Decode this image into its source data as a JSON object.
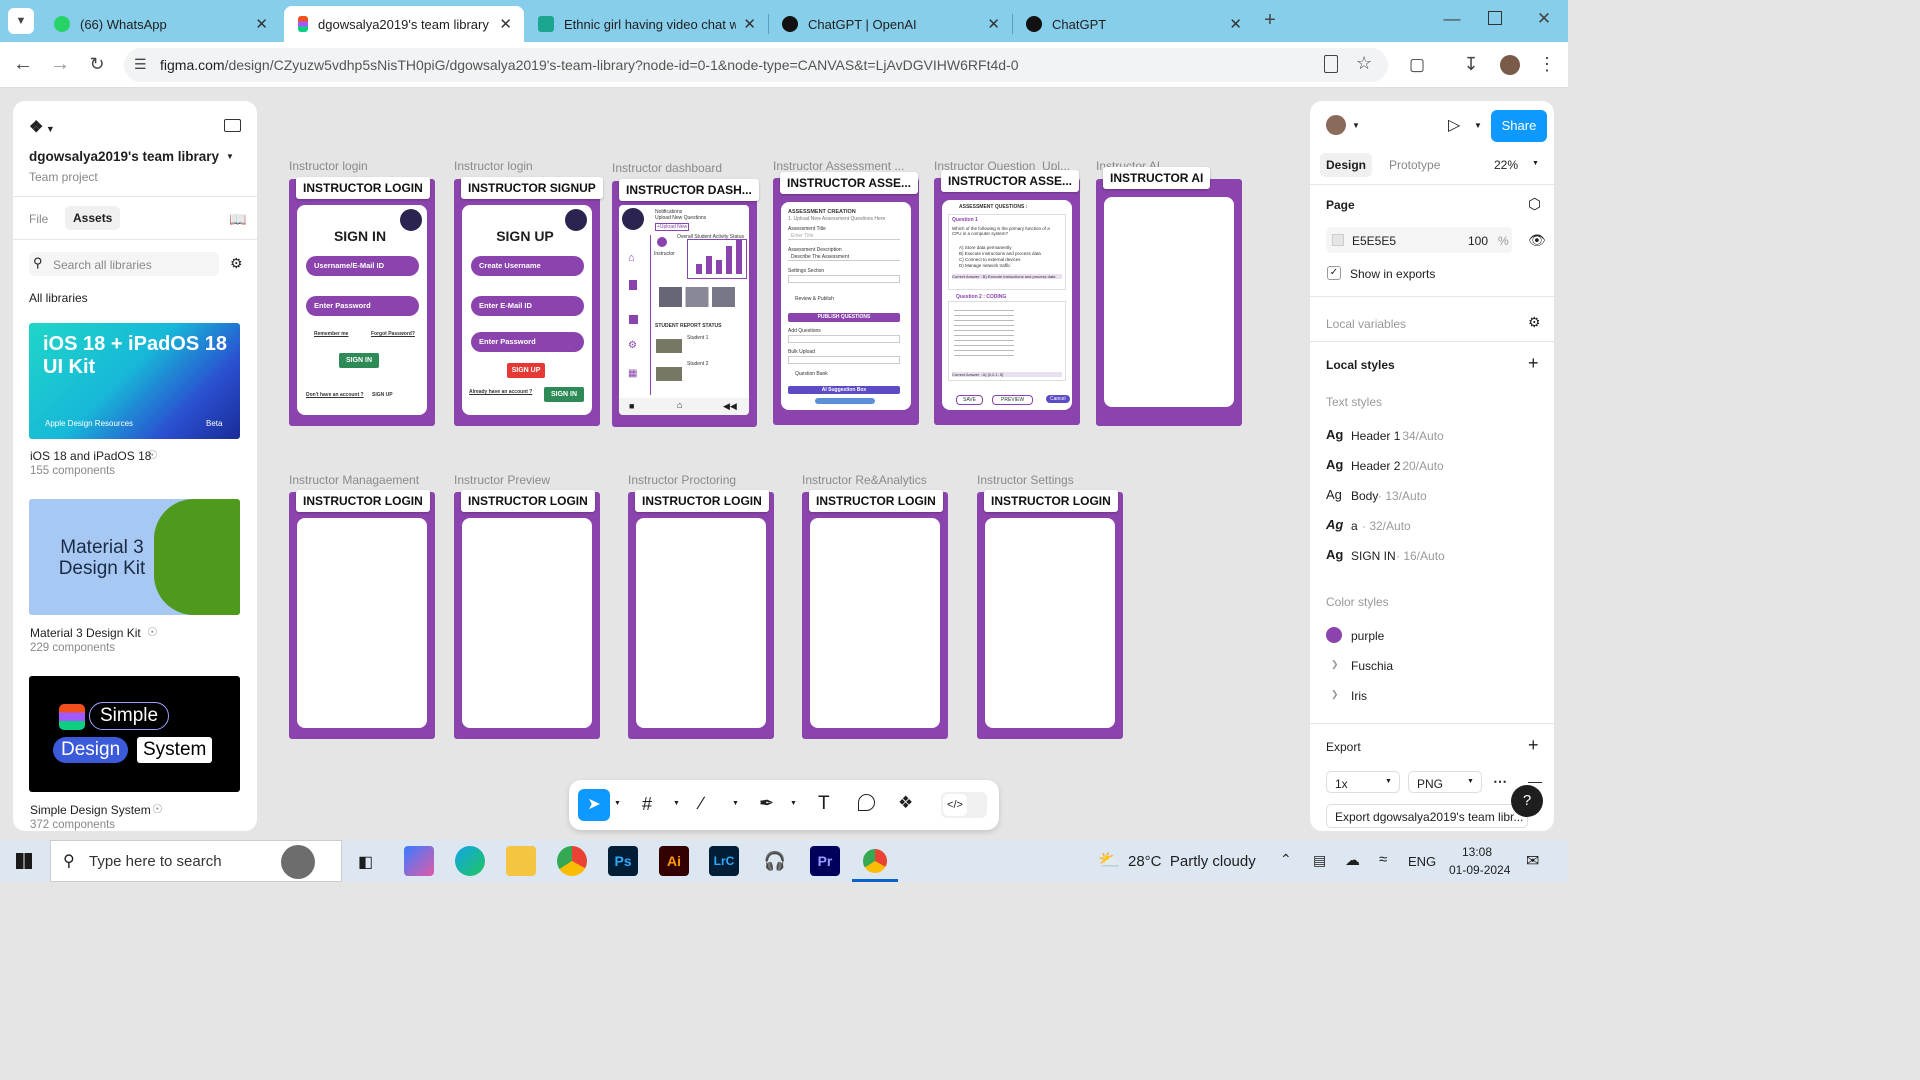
{
  "browser": {
    "tabs": [
      {
        "title": "(66) WhatsApp",
        "active": false,
        "favicon": "whatsapp-icon",
        "color": "#25d366"
      },
      {
        "title": "dgowsalya2019's team library –",
        "active": true,
        "favicon": "figma-icon",
        "color": "#f24e1e"
      },
      {
        "title": "Ethnic girl having video chat wi",
        "active": false,
        "favicon": "freepik-icon",
        "color": "#1aa68f"
      },
      {
        "title": "ChatGPT | OpenAI",
        "active": false,
        "favicon": "openai-icon",
        "color": "#111111"
      },
      {
        "title": "ChatGPT",
        "active": false,
        "favicon": "openai-icon",
        "color": "#111111"
      }
    ],
    "url_host": "figma.com",
    "url_path": "/design/CZyuzw5vdhp5sNisTH0piG/dgowsalya2019's-team-library?node-id=0-1&node-type=CANVAS&t=LjAvDGVIHW6RFt4d-0"
  },
  "left_panel": {
    "team_name": "dgowsalya2019's team library",
    "project_label": "Team project",
    "tabs": [
      "File",
      "Assets"
    ],
    "active_tab": "Assets",
    "search_placeholder": "Search all libraries",
    "section_title": "All libraries",
    "libraries": [
      {
        "name": "iOS 18 and iPadOS 18",
        "count": "155 components",
        "thumb_title": "iOS 18 + iPadOS 18 UI Kit",
        "thumb_sub": "Apple Design Resources",
        "thumb_badge": "Beta"
      },
      {
        "name": "Material 3 Design Kit",
        "count": "229 components",
        "thumb_title": "Material 3 Design Kit"
      },
      {
        "name": "Simple Design System",
        "count": "372 components",
        "thumb_words": [
          "Simple",
          "Design",
          "System"
        ]
      }
    ]
  },
  "canvas": {
    "row1": [
      {
        "label": "Instructor login",
        "title": "INSTRUCTOR LOGIN"
      },
      {
        "label": "Instructor login",
        "title": "INSTRUCTOR SIGNUP"
      },
      {
        "label": "Instructor dashboard",
        "title": "INSTRUCTOR DASH..."
      },
      {
        "label": "Instructor Assessment ...",
        "title": "INSTRUCTOR ASSE..."
      },
      {
        "label": "Instructor Question_Upl...",
        "title": "INSTRUCTOR ASSE..."
      },
      {
        "label": "Instructor AI",
        "title": "INSTRUCTOR AI"
      }
    ],
    "row2": [
      {
        "label": "Instructor Managaement",
        "title": "INSTRUCTOR LOGIN"
      },
      {
        "label": "Instructor Preview",
        "title": "INSTRUCTOR LOGIN"
      },
      {
        "label": "Instructor Proctoring",
        "title": "INSTRUCTOR LOGIN"
      },
      {
        "label": "Instructor Re&Analytics",
        "title": "INSTRUCTOR LOGIN"
      },
      {
        "label": "Instructor Settings",
        "title": "INSTRUCTOR LOGIN"
      }
    ],
    "signin": {
      "heading": "SIGN IN",
      "user_field": "Username/E-Mail ID",
      "password_field": "Enter Password",
      "remember": "Remember me",
      "forgot": "Forgot Password?",
      "button": "SIGN IN",
      "no_account": "Don't have an account ?",
      "signup_link": "SIGN UP"
    },
    "signup": {
      "heading": "SIGN UP",
      "user_field": "Create Username",
      "email_field": "Enter E-Mail ID",
      "password_field": "Enter Password",
      "signup_button": "SIGN UP",
      "have_account": "Already have an account ?",
      "signin_button": "SIGN IN"
    },
    "dashboard": {
      "notifications": "Notifications",
      "upload": "Upload New Questions",
      "upload_btn": "+Upload New",
      "instructor": "Instructor",
      "overall": "Overall Student  Activity Status",
      "report": "STUDENT REPORT STATUS",
      "student1": "Student 1",
      "student2": "Student 2"
    },
    "assessment": {
      "heading": "ASSESSMENT CREATION",
      "sub": "1. Upload New Assessment Questions Here",
      "title_label": "Assessment Title",
      "title_value": "Enter Title",
      "desc_label": "Assessment Description",
      "desc_value": "Describe The Assessment",
      "settings": "Settings Section",
      "review": "Review & Publish",
      "publish": "PUBLISH QUESTIONS",
      "add_q": "Add Questions",
      "bulk": "Bulk Upload",
      "bank": "Question Bank",
      "suggestion": "AI Suggestion Box"
    },
    "questions": {
      "heading": "ASSESSMENT QUESTIONS :",
      "q1": "Question 1",
      "q1_text": "Which of the following is the primary function of a CPU in a computer system?",
      "options": [
        "A) Store data permanently",
        "B) Execute instructions and process data",
        "C) Connect to external devices",
        "D) Manage network traffic"
      ],
      "q1_answer": "Correct Answer : B) Execute instructions and process data",
      "q2": "Question 2 : CODING",
      "q2_answer": "Correct Answer : A) [3,2,1, 5]",
      "save": "SAVE",
      "preview": "PREVIEW",
      "cancel": "Cancel"
    }
  },
  "right_panel": {
    "tabs": [
      "Design",
      "Prototype"
    ],
    "active_tab": "Design",
    "zoom": "22%",
    "share": "Share",
    "page_title": "Page",
    "page_color": "E5E5E5",
    "page_opacity": "100",
    "opacity_unit": "%",
    "show_in_exports": "Show in exports",
    "local_variables": "Local variables",
    "local_styles": "Local styles",
    "text_styles_title": "Text styles",
    "text_styles": [
      {
        "name": "Header 1",
        "meta": "· 34/Auto"
      },
      {
        "name": "Header 2",
        "meta": "· 20/Auto"
      },
      {
        "name": "Body",
        "meta": "· 13/Auto"
      },
      {
        "name": "a",
        "meta": "· 32/Auto"
      },
      {
        "name": "SIGN IN",
        "meta": "· 16/Auto"
      }
    ],
    "color_styles_title": "Color styles",
    "color_styles": [
      "purple",
      "Fuschia",
      "Iris"
    ],
    "export_title": "Export",
    "export_scale": "1x",
    "export_format": "PNG",
    "export_button": "Export dgowsalya2019's team libr..."
  },
  "taskbar": {
    "search_placeholder": "Type here to search",
    "weather": "28°C  Partly cloudy",
    "language": "ENG",
    "time": "13:08",
    "date": "01-09-2024",
    "apps": [
      "copilot-icon",
      "edge-icon",
      "file-explorer-icon",
      "chrome-icon",
      "photoshop-icon",
      "illustrator-icon",
      "lightroom-classic-icon",
      "headphones-app-icon",
      "premiere-icon",
      "chrome-profile-icon"
    ]
  },
  "colors": {
    "frame_purple": "#8b44ad",
    "figma_blue": "#0d99ff",
    "tabbar": "#87ceeb"
  }
}
